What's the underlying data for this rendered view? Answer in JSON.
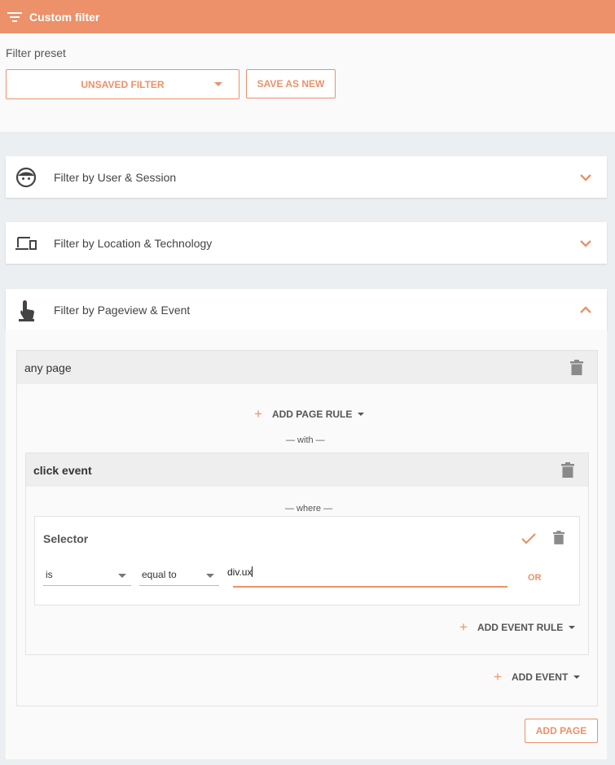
{
  "header": {
    "title": "Custom filter",
    "icon": "filter-icon"
  },
  "preset": {
    "label": "Filter preset",
    "selected": "UNSAVED FILTER",
    "save_as_new": "SAVE AS NEW"
  },
  "sections": [
    {
      "label": "Filter by User & Session",
      "icon": "user-face-icon",
      "expanded": false
    },
    {
      "label": "Filter by Location & Technology",
      "icon": "devices-icon",
      "expanded": false
    },
    {
      "label": "Filter by Pageview & Event",
      "icon": "touch-icon",
      "expanded": true
    }
  ],
  "page": {
    "title": "any page",
    "add_page_rule": "ADD PAGE RULE",
    "with_text": "— with —",
    "event": {
      "title": "click event",
      "where_text": "— where —",
      "rule": {
        "title": "Selector",
        "operator1": "is",
        "operator2": "equal to",
        "value": "div.ux",
        "or_label": "OR"
      },
      "add_event_rule": "ADD EVENT RULE"
    },
    "add_event": "ADD EVENT"
  },
  "add_page": "ADD PAGE",
  "colors": {
    "accent": "#ec916a",
    "background": "#eceff1"
  }
}
